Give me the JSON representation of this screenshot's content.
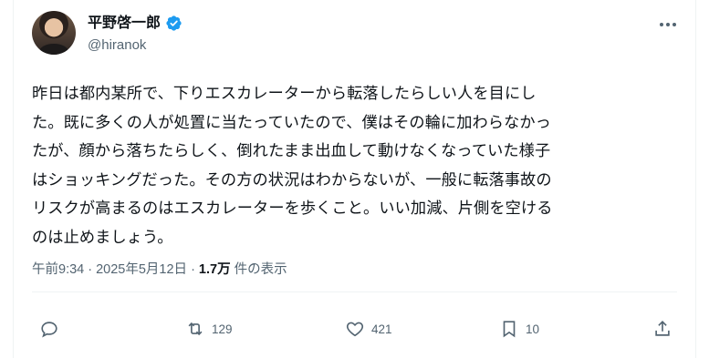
{
  "author": {
    "display_name": "平野啓一郎",
    "handle": "@hiranok",
    "avatar_icon": "user-avatar",
    "verified_icon": "verified-badge-icon",
    "verified_color": "#1d9bf0"
  },
  "post": {
    "text": "昨日は都内某所で、下りエスカレーターから転落したらしい人を目にし\nた。既に多くの人が処置に当たっていたので、僕はその輪に加わらなかっ\nたが、顔から落ちたらしく、倒れたまま出血して動けなくなっていた様子\nはショッキングだった。その方の状況はわからないが、一般に転落事故の\nリスクが高まるのはエスカレーターを歩くこと。いい加減、片側を空ける\nのは止めましょう。",
    "timestamp": "午前9:34 · 2025年5月12日 · ",
    "views_count": "1.7万",
    "views_label": "件の表示"
  },
  "actions": {
    "reply": {
      "icon": "reply-icon",
      "count": ""
    },
    "repost": {
      "icon": "repost-icon",
      "count": "129"
    },
    "like": {
      "icon": "heart-icon",
      "count": "421"
    },
    "bookmark": {
      "icon": "bookmark-icon",
      "count": "10"
    },
    "share": {
      "icon": "share-icon"
    }
  },
  "menu": {
    "icon": "more-options-icon"
  },
  "colors": {
    "text": "#0f1419",
    "muted": "#536471",
    "border": "#eff3f4"
  }
}
